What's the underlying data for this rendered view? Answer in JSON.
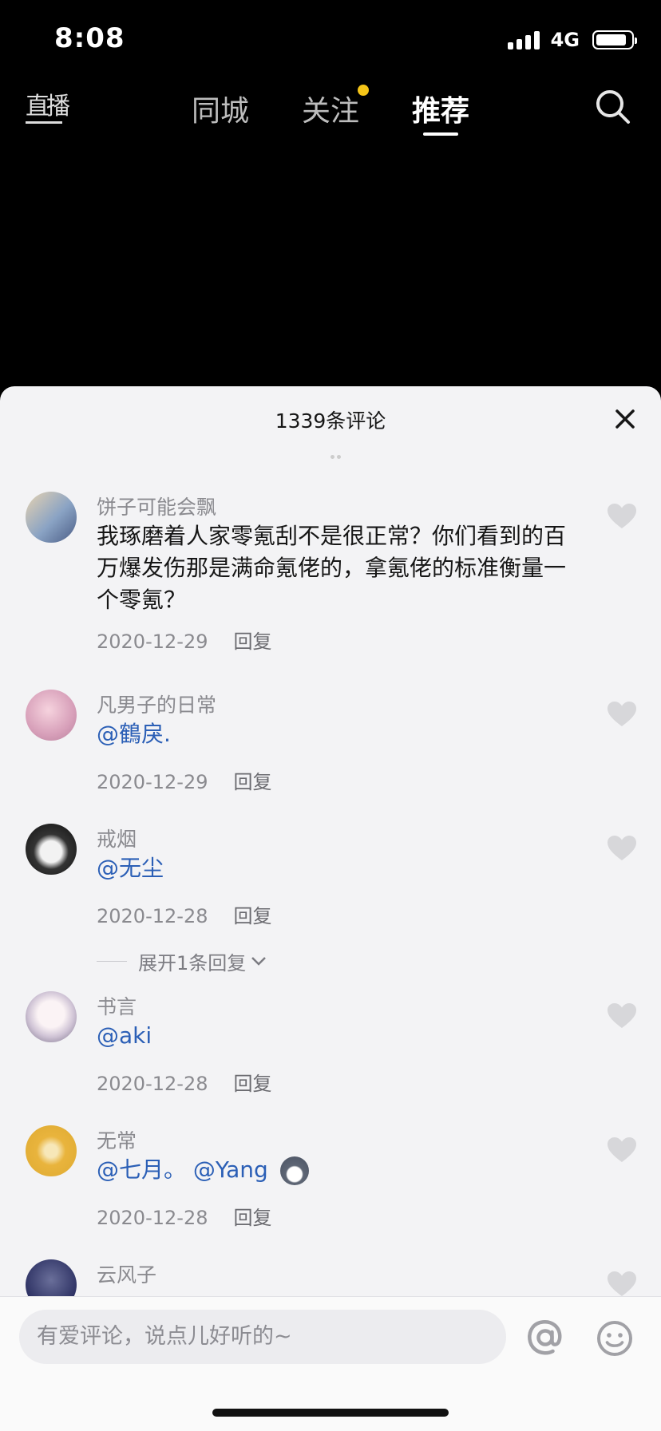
{
  "status_bar": {
    "time": "8:08",
    "network": "4G"
  },
  "top_nav": {
    "live_label": "直播",
    "tabs": [
      {
        "label": "同城"
      },
      {
        "label": "关注"
      },
      {
        "label": "推荐"
      }
    ]
  },
  "comments_sheet": {
    "title": "1339条评论",
    "comments": [
      {
        "user": "饼子可能会飘",
        "text": "我琢磨着人家零氪刮不是很正常？你们看到的百万爆发伤那是满命氪佬的，拿氪佬的标准衡量一个零氪？",
        "date": "2020-12-29",
        "reply": "回复"
      },
      {
        "user": "凡男子的日常",
        "mention": "@鶴戾.",
        "date": "2020-12-29",
        "reply": "回复"
      },
      {
        "user": "戒烟",
        "mention": "@无尘",
        "date": "2020-12-28",
        "reply": "回复"
      },
      {
        "user": "书言",
        "mention": "@aki",
        "date": "2020-12-28",
        "reply": "回复"
      },
      {
        "user": "无常",
        "mention": "@七月。 @Yang",
        "date": "2020-12-28",
        "reply": "回复"
      },
      {
        "user": "云风子"
      }
    ],
    "expand_label": "展开1条回复"
  },
  "input_bar": {
    "placeholder": "有爱评论，说点儿好听的~"
  }
}
